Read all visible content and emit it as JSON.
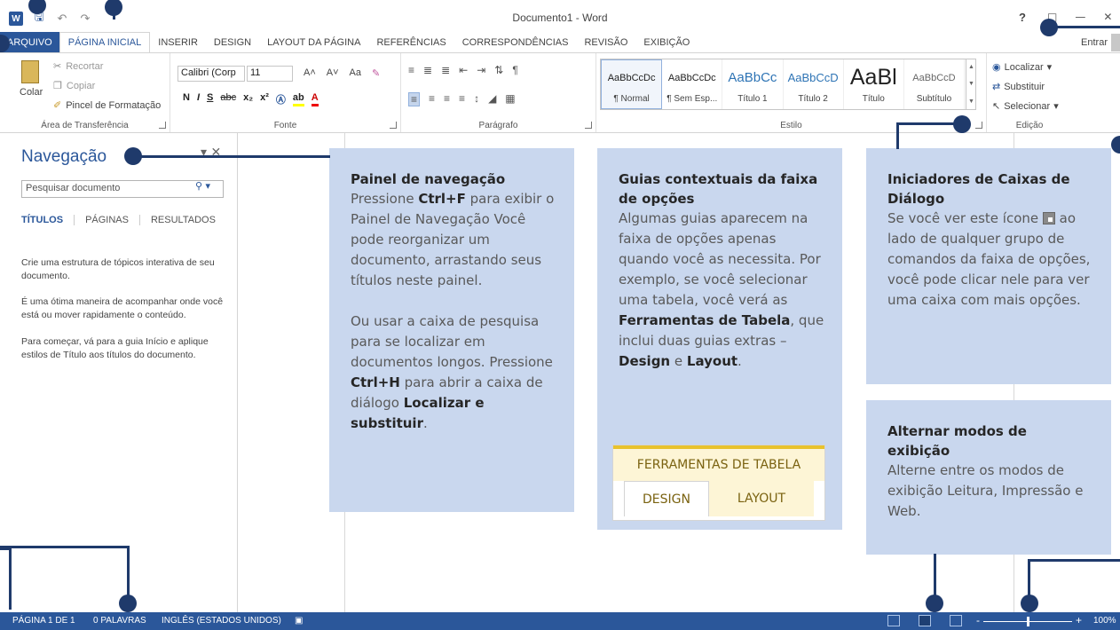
{
  "window": {
    "title": "Documento1 - Word",
    "help": "?",
    "sign_in": "Entrar"
  },
  "qat": {
    "app_icon": "W",
    "save_icon": "save-icon",
    "undo_icon": "undo-icon",
    "redo_icon": "redo-icon"
  },
  "tabs": {
    "file": "ARQUIVO",
    "home": "PÁGINA INICIAL",
    "insert": "INSERIR",
    "design": "DESIGN",
    "layout": "LAYOUT DA PÁGINA",
    "references": "REFERÊNCIAS",
    "mailings": "CORRESPONDÊNCIAS",
    "review": "REVISÃO",
    "view": "EXIBIÇÃO"
  },
  "ribbon": {
    "clipboard": {
      "label": "Área de Transferência",
      "paste": "Colar",
      "cut": "Recortar",
      "copy": "Copiar",
      "format_painter": "Pincel de Formatação"
    },
    "font": {
      "label": "Fonte",
      "name": "Calibri (Corp",
      "size": "11",
      "bold": "N",
      "italic": "I",
      "underline": "S",
      "strike": "abc",
      "subscript": "x₂",
      "superscript": "x²",
      "grow": "A˄",
      "shrink": "A˅",
      "case": "Aa",
      "highlight": "ab",
      "color": "A"
    },
    "paragraph": {
      "label": "Parágrafo"
    },
    "styles": {
      "label": "Estilo",
      "items": [
        {
          "sample": "AaBbCcDc",
          "name": "¶ Normal"
        },
        {
          "sample": "AaBbCcDc",
          "name": "¶ Sem Esp..."
        },
        {
          "sample": "AaBbCc",
          "name": "Título 1"
        },
        {
          "sample": "AaBbCcD",
          "name": "Título 2"
        },
        {
          "sample": "AaBl",
          "name": "Título"
        },
        {
          "sample": "AaBbCcD",
          "name": "Subtítulo"
        }
      ]
    },
    "editing": {
      "label": "Edição",
      "find": "Localizar",
      "replace": "Substituir",
      "select": "Selecionar"
    }
  },
  "nav": {
    "title": "Navegação",
    "search_placeholder": "Pesquisar documento",
    "tab_headings": "TÍTULOS",
    "tab_pages": "PÁGINAS",
    "tab_results": "RESULTADOS",
    "para1": "Crie uma estrutura de tópicos interativa de seu documento.",
    "para2": "É uma ótima maneira de acompanhar onde você está ou mover rapidamente o conteúdo.",
    "para3": "Para começar, vá para a guia Início e aplique estilos de Título aos títulos do documento."
  },
  "callouts": {
    "nav_pane": {
      "title": "Painel de navegação",
      "t1": "Pressione ",
      "k1": "Ctrl+F",
      "t2": " para exibir o Painel de Navegação Você pode reorganizar um documento, arrastando seus títulos neste painel.",
      "t3": "Ou usar a caixa de pesquisa para se localizar em documentos longos. Pressione ",
      "k2": "Ctrl+H",
      "t4": " para abrir a caixa de diálogo ",
      "k3": "Localizar e substituir",
      "t5": "."
    },
    "contextual": {
      "title": "Guias contextuais da faixa de opções",
      "t1": "Algumas guias aparecem na faixa de opções apenas quando você as necessita. Por exemplo, se você selecionar uma tabela, você verá as ",
      "k1": "Ferramentas de Tabela",
      "t2": ", que inclui duas guias extras – ",
      "k2": "Design",
      "t3": " e ",
      "k3": "Layout",
      "t4": ".",
      "table_tools": "FERRAMENTAS DE TABELA",
      "table_design": "DESIGN",
      "table_layout": "LAYOUT"
    },
    "dialog": {
      "title": "Iniciadores de Caixas de Diálogo",
      "t1": "Se você ver este ícone ",
      "t2": " ao lado de qualquer grupo de comandos da faixa de opções, você pode clicar nele para ver uma caixa com mais opções."
    },
    "views": {
      "title": "Alternar modos de exibição",
      "text": "Alterne entre os modos de exibição Leitura, Impressão e Web."
    }
  },
  "status": {
    "page": "PÁGINA 1 DE 1",
    "words": "0 PALAVRAS",
    "language": "INGLÊS (ESTADOS UNIDOS)",
    "zoom": "100%",
    "zoom_minus": "-",
    "zoom_plus": "+"
  },
  "colors": {
    "accent": "#2b579a",
    "callout": "#c9d7ee",
    "leader": "#1f3a6b"
  }
}
